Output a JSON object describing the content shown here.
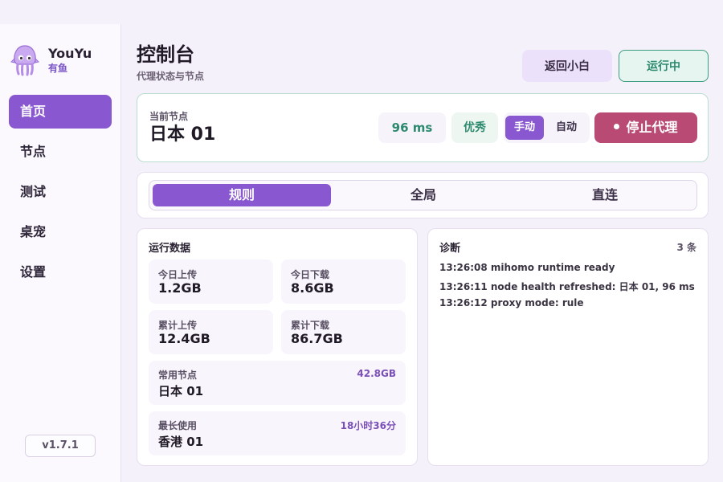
{
  "brand": {
    "name": "YouYu",
    "subtitle": "有鱼",
    "logo_icon": "squid-icon"
  },
  "nav": {
    "items": [
      {
        "label": "首页",
        "active": true
      },
      {
        "label": "节点",
        "active": false
      },
      {
        "label": "测试",
        "active": false
      },
      {
        "label": "桌宠",
        "active": false
      },
      {
        "label": "设置",
        "active": false
      }
    ]
  },
  "version": "v1.7.1",
  "header": {
    "title": "控制台",
    "subtitle": "代理状态与节点",
    "back_label": "返回小白",
    "status_label": "运行中"
  },
  "node": {
    "label": "当前节点",
    "name": "日本 01",
    "latency": "96 ms",
    "quality": "优秀",
    "manual_label": "手动",
    "auto_label": "自动",
    "stop_label": "停止代理"
  },
  "mode": {
    "options": [
      "规则",
      "全局",
      "直连"
    ],
    "selected": "规则"
  },
  "stats": {
    "title": "运行数据",
    "today_up_label": "今日上传",
    "today_up": "1.2GB",
    "today_down_label": "今日下载",
    "today_down": "8.6GB",
    "total_up_label": "累计上传",
    "total_up": "12.4GB",
    "total_down_label": "累计下载",
    "total_down": "86.7GB",
    "frequent_label": "常用节点",
    "frequent_name": "日本 01",
    "frequent_value": "42.8GB",
    "longest_label": "最长使用",
    "longest_name": "香港 01",
    "longest_value": "18小时36分"
  },
  "diagnostics": {
    "title": "诊断",
    "count": "3 条",
    "lines": [
      "13:26:08 mihomo runtime ready",
      "13:26:11 node health refreshed: 日本 01, 96 ms",
      "13:26:12 proxy mode: rule"
    ]
  },
  "colors": {
    "accent": "#8957cf",
    "success": "#2d8a6e",
    "danger": "#b94a73",
    "background": "#f5f1fb"
  }
}
